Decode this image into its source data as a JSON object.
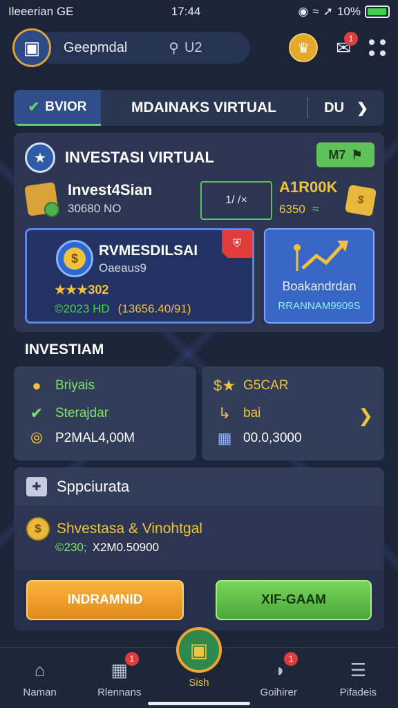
{
  "status_bar": {
    "carrier": "Ileeerian GE",
    "time": "17:44",
    "battery": "10%",
    "battery_level": 0.95
  },
  "header": {
    "app_name": "Geepmdal",
    "search_text": "U2",
    "inbox_badge": "1"
  },
  "tabs": {
    "active_label": "BVIOR",
    "middle_label": "MDAINAKS VIRTUAL",
    "right_label": "DU"
  },
  "section1": {
    "title": "INVESTASI VIRTUAL",
    "badge": "M7",
    "investment": {
      "name": "Invest4Sian",
      "sub": "30680 NO"
    },
    "chart_label": "1/ /×",
    "ai": {
      "title": "A1R00K",
      "sub": "6350"
    },
    "inv_card": {
      "title": "RVMESDILSAI",
      "sub": "Oaeaus9",
      "rating": "★★★302",
      "value_green": "©2023 HD",
      "value_gold": "(13656.40/91)"
    },
    "board_card": {
      "title": "Boakandrdan",
      "sub": "RRANNAM9909S"
    }
  },
  "section2": {
    "title": "INVESTIAM",
    "left": {
      "row1": "Briyais",
      "row2": "Sterajdar",
      "row3": "P2MAL4,00M"
    },
    "right": {
      "row1": "G5CAR",
      "row2": "bai",
      "row3": "00.0,3000"
    }
  },
  "section3": {
    "title": "Sppciurata",
    "line1": "Shvestasa & Vinohtgal",
    "line2_green": "©230;",
    "line2_text": "X2M0.50900",
    "btn_left": "INDRAMNID",
    "btn_right": "XIF-GAAM"
  },
  "bottom_nav": {
    "items": [
      {
        "label": "Naman",
        "icon": "home-icon"
      },
      {
        "label": "Rlennans",
        "icon": "profile-card-icon",
        "badge": "1"
      },
      {
        "label": "Sish",
        "icon": "box-icon"
      },
      {
        "label": "Goihirer",
        "icon": "gauge-icon",
        "badge": "1"
      },
      {
        "label": "Pifadeis",
        "icon": "menu-icon"
      }
    ]
  },
  "colors": {
    "background": "#1b2438",
    "accent_green": "#5ec25a",
    "accent_gold": "#f2c23c",
    "accent_blue": "#3766c6",
    "alert_red": "#e23b3b"
  }
}
